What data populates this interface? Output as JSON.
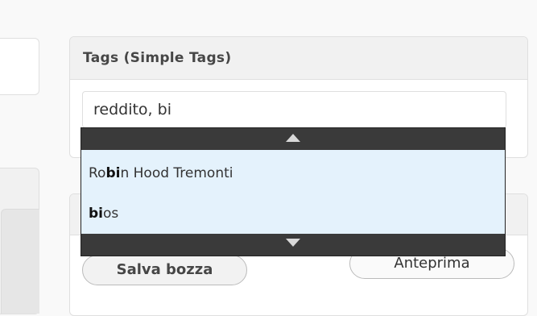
{
  "tags_box": {
    "title": "Tags (Simple Tags)",
    "input_value": "reddito, bi"
  },
  "suggestions": [
    {
      "pre": "Ro",
      "match": "bi",
      "post": "n Hood Tremonti"
    },
    {
      "pre": "",
      "match": "bi",
      "post": "os"
    }
  ],
  "icons": {
    "scroll_up": "chevron-up-icon",
    "scroll_down": "chevron-down-icon"
  },
  "publish": {
    "save_draft_label": "Salva bozza",
    "preview_label": "Anteprima"
  }
}
